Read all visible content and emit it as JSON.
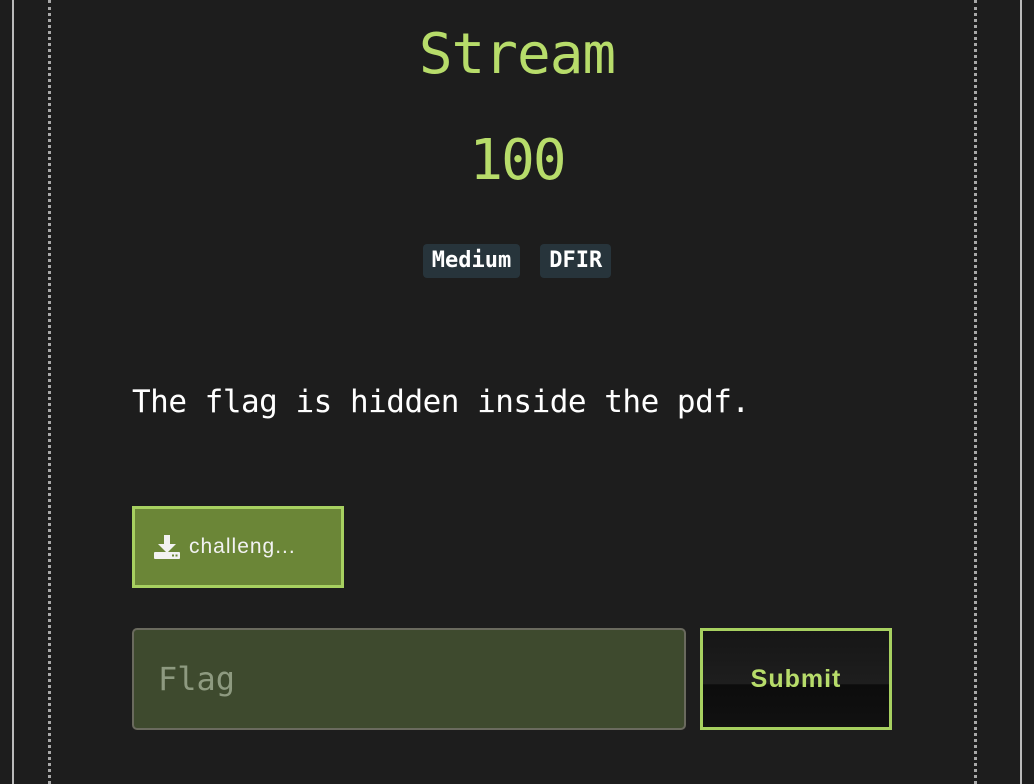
{
  "challenge": {
    "title": "Stream",
    "points": "100",
    "tags": [
      "Medium",
      "DFIR"
    ],
    "description": "The flag is hidden inside the pdf."
  },
  "attachment": {
    "label": "challeng...",
    "icon": "download-icon"
  },
  "form": {
    "flag_placeholder": "Flag",
    "flag_value": "",
    "submit_label": "Submit"
  },
  "colors": {
    "accent": "#b7dc6a",
    "button_fill": "#6b8637",
    "tag_background": "#27343b",
    "background": "#1d1d1d"
  }
}
